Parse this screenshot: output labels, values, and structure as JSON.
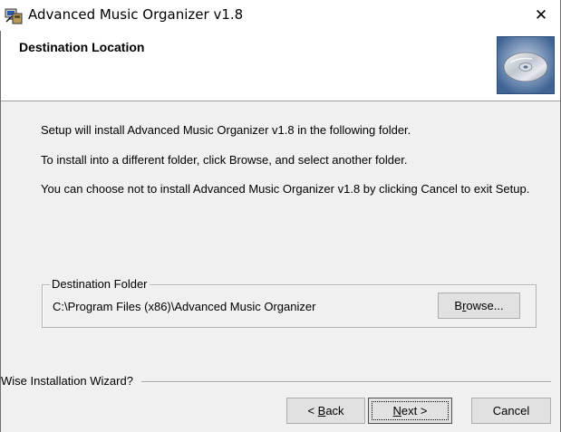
{
  "window": {
    "title": "Advanced Music Organizer v1.8",
    "close_glyph": "✕",
    "icon": "installer-computer-icon"
  },
  "header": {
    "title": "Destination Location",
    "image": "cd-disc-icon"
  },
  "body": {
    "line1": "Setup will install Advanced Music Organizer v1.8 in the following folder.",
    "line2": "To install into a different folder, click Browse, and select another folder.",
    "line3": "You can choose not to install Advanced Music Organizer v1.8 by clicking Cancel to exit Setup."
  },
  "destination": {
    "group_label": "Destination Folder",
    "path": "C:\\Program Files (x86)\\Advanced Music Organizer",
    "browse_pre": "B",
    "browse_mnemonic": "r",
    "browse_post": "owse..."
  },
  "footer": {
    "wizard_label": "Wise Installation Wizard?",
    "back_pre": "< ",
    "back_mnemonic": "B",
    "back_post": "ack",
    "next_mnemonic": "N",
    "next_post": "ext >",
    "cancel_label": "Cancel"
  },
  "colors": {
    "dialog_background": "#f0f0f0",
    "header_background": "#ffffff",
    "button_face": "#e1e1e1"
  }
}
